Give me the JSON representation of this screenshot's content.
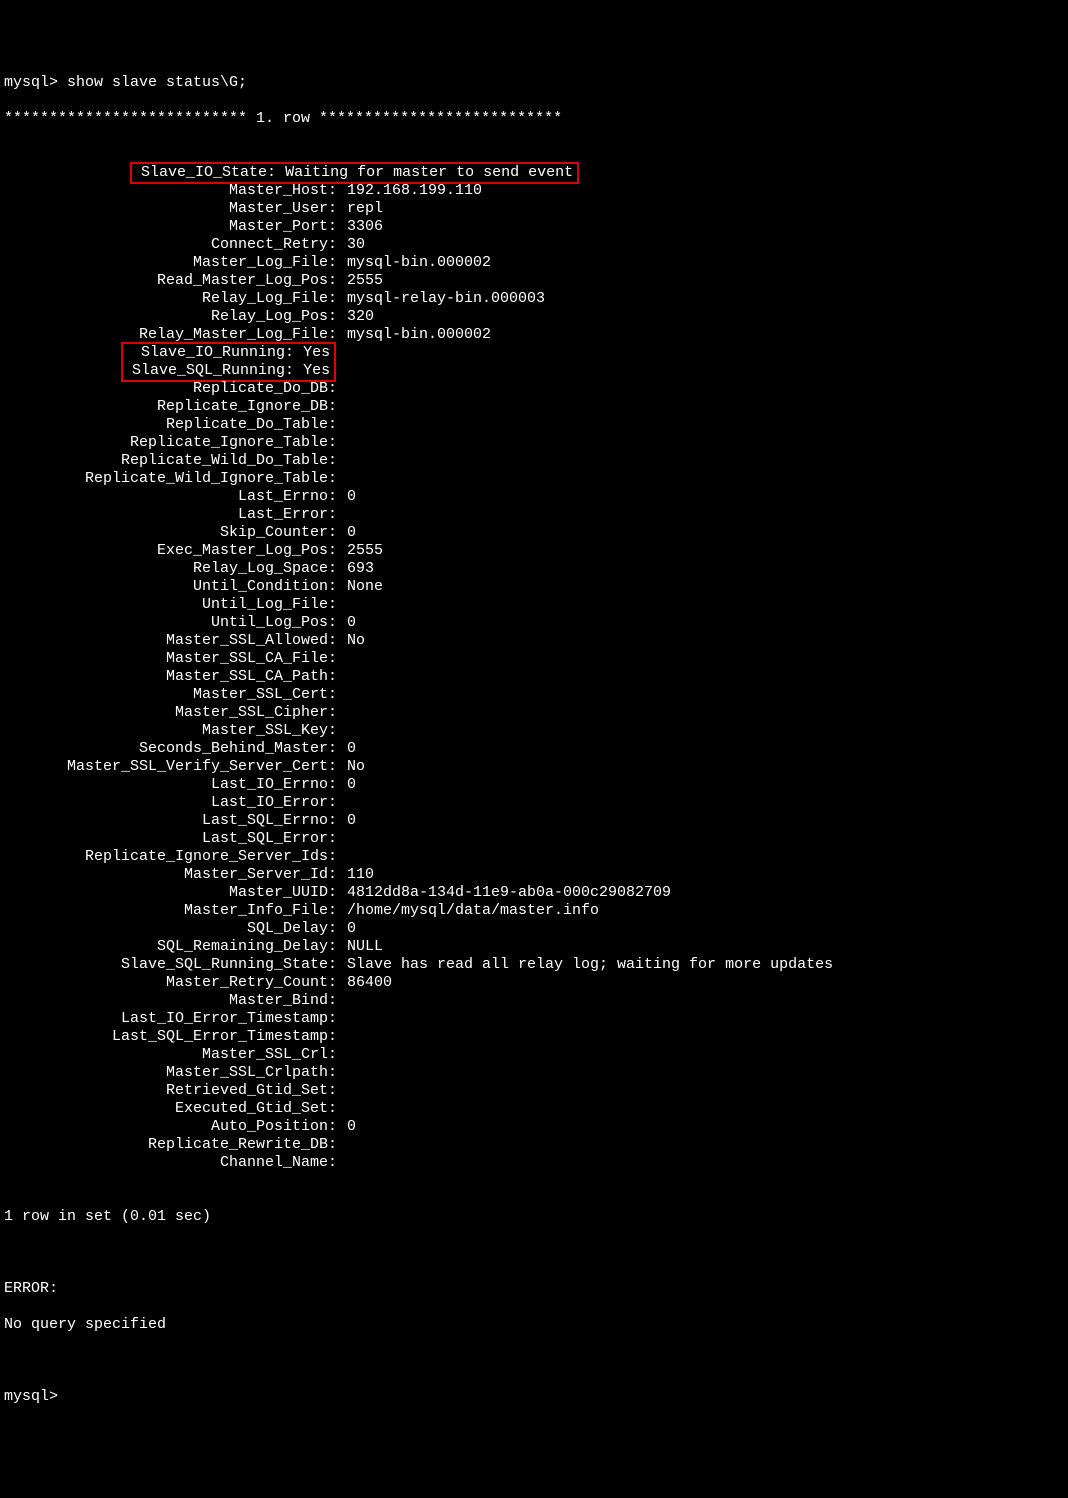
{
  "prompt1": "mysql> show slave status\\G;",
  "header": "*************************** 1. row ***************************",
  "rows": [
    {
      "k": "Slave_IO_State",
      "v": "Waiting for master to send event",
      "hl": "single"
    },
    {
      "k": "Master_Host",
      "v": "192.168.199.110"
    },
    {
      "k": "Master_User",
      "v": "repl"
    },
    {
      "k": "Master_Port",
      "v": "3306"
    },
    {
      "k": "Connect_Retry",
      "v": "30"
    },
    {
      "k": "Master_Log_File",
      "v": "mysql-bin.000002"
    },
    {
      "k": "Read_Master_Log_Pos",
      "v": "2555"
    },
    {
      "k": "Relay_Log_File",
      "v": "mysql-relay-bin.000003"
    },
    {
      "k": "Relay_Log_Pos",
      "v": "320"
    },
    {
      "k": "Relay_Master_Log_File",
      "v": "mysql-bin.000002"
    },
    {
      "k": "Slave_IO_Running",
      "v": "Yes",
      "hl": "block-start"
    },
    {
      "k": "Slave_SQL_Running",
      "v": "Yes",
      "hl": "block-end"
    },
    {
      "k": "Replicate_Do_DB",
      "v": ""
    },
    {
      "k": "Replicate_Ignore_DB",
      "v": ""
    },
    {
      "k": "Replicate_Do_Table",
      "v": ""
    },
    {
      "k": "Replicate_Ignore_Table",
      "v": ""
    },
    {
      "k": "Replicate_Wild_Do_Table",
      "v": ""
    },
    {
      "k": "Replicate_Wild_Ignore_Table",
      "v": ""
    },
    {
      "k": "Last_Errno",
      "v": "0"
    },
    {
      "k": "Last_Error",
      "v": ""
    },
    {
      "k": "Skip_Counter",
      "v": "0"
    },
    {
      "k": "Exec_Master_Log_Pos",
      "v": "2555"
    },
    {
      "k": "Relay_Log_Space",
      "v": "693"
    },
    {
      "k": "Until_Condition",
      "v": "None"
    },
    {
      "k": "Until_Log_File",
      "v": ""
    },
    {
      "k": "Until_Log_Pos",
      "v": "0"
    },
    {
      "k": "Master_SSL_Allowed",
      "v": "No"
    },
    {
      "k": "Master_SSL_CA_File",
      "v": ""
    },
    {
      "k": "Master_SSL_CA_Path",
      "v": ""
    },
    {
      "k": "Master_SSL_Cert",
      "v": ""
    },
    {
      "k": "Master_SSL_Cipher",
      "v": ""
    },
    {
      "k": "Master_SSL_Key",
      "v": ""
    },
    {
      "k": "Seconds_Behind_Master",
      "v": "0"
    },
    {
      "k": "Master_SSL_Verify_Server_Cert",
      "v": "No"
    },
    {
      "k": "Last_IO_Errno",
      "v": "0"
    },
    {
      "k": "Last_IO_Error",
      "v": ""
    },
    {
      "k": "Last_SQL_Errno",
      "v": "0"
    },
    {
      "k": "Last_SQL_Error",
      "v": ""
    },
    {
      "k": "Replicate_Ignore_Server_Ids",
      "v": ""
    },
    {
      "k": "Master_Server_Id",
      "v": "110"
    },
    {
      "k": "Master_UUID",
      "v": "4812dd8a-134d-11e9-ab0a-000c29082709"
    },
    {
      "k": "Master_Info_File",
      "v": "/home/mysql/data/master.info"
    },
    {
      "k": "SQL_Delay",
      "v": "0"
    },
    {
      "k": "SQL_Remaining_Delay",
      "v": "NULL"
    },
    {
      "k": "Slave_SQL_Running_State",
      "v": "Slave has read all relay log; waiting for more updates"
    },
    {
      "k": "Master_Retry_Count",
      "v": "86400"
    },
    {
      "k": "Master_Bind",
      "v": ""
    },
    {
      "k": "Last_IO_Error_Timestamp",
      "v": ""
    },
    {
      "k": "Last_SQL_Error_Timestamp",
      "v": ""
    },
    {
      "k": "Master_SSL_Crl",
      "v": ""
    },
    {
      "k": "Master_SSL_Crlpath",
      "v": ""
    },
    {
      "k": "Retrieved_Gtid_Set",
      "v": ""
    },
    {
      "k": "Executed_Gtid_Set",
      "v": ""
    },
    {
      "k": "Auto_Position",
      "v": "0"
    },
    {
      "k": "Replicate_Rewrite_DB",
      "v": ""
    },
    {
      "k": "Channel_Name",
      "v": ""
    }
  ],
  "footer1": "1 row in set (0.01 sec)",
  "blank": "",
  "err1": "ERROR:",
  "err2": "No query specified",
  "prompt2": "mysql> "
}
